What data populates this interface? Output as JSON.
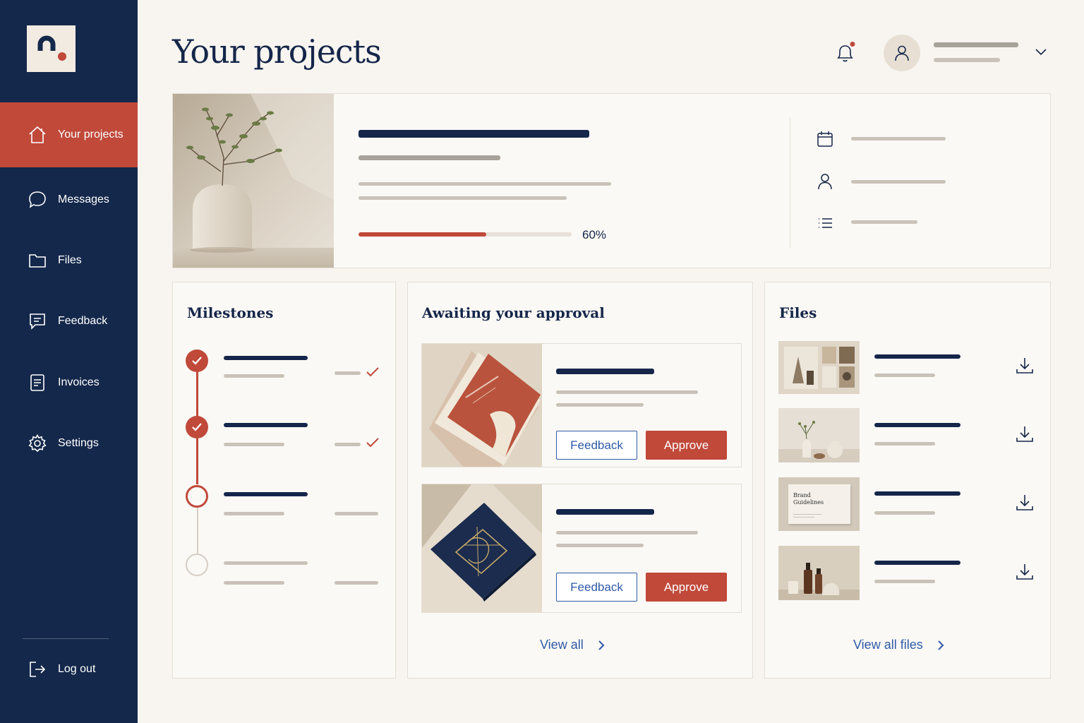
{
  "sidebar": {
    "items": [
      {
        "label": "Your projects",
        "icon": "home-icon"
      },
      {
        "label": "Messages",
        "icon": "chat-icon"
      },
      {
        "label": "Files",
        "icon": "folder-icon"
      },
      {
        "label": "Feedback",
        "icon": "feedback-icon"
      },
      {
        "label": "Invoices",
        "icon": "document-icon"
      },
      {
        "label": "Settings",
        "icon": "gear-icon"
      }
    ],
    "logout": {
      "label": "Log out",
      "icon": "logout-icon"
    }
  },
  "header": {
    "title": "Your projects",
    "has_notification": true
  },
  "project": {
    "progress_percent": 60,
    "progress_label": "60%"
  },
  "milestones": {
    "title": "Milestones",
    "items": [
      {
        "status": "done"
      },
      {
        "status": "done"
      },
      {
        "status": "current"
      },
      {
        "status": "todo"
      }
    ]
  },
  "approvals": {
    "title": "Awaiting your approval",
    "items": [
      {
        "feedback_label": "Feedback",
        "approve_label": "Approve"
      },
      {
        "feedback_label": "Feedback",
        "approve_label": "Approve"
      }
    ],
    "view_all_label": "View all"
  },
  "files": {
    "title": "Files",
    "thumb_3_text": "Brand\nGuidelines",
    "view_all_label": "View all files"
  },
  "colors": {
    "navy": "#14284b",
    "accent": "#c0493a",
    "link": "#2f5aa8",
    "background": "#f8f5f0"
  }
}
